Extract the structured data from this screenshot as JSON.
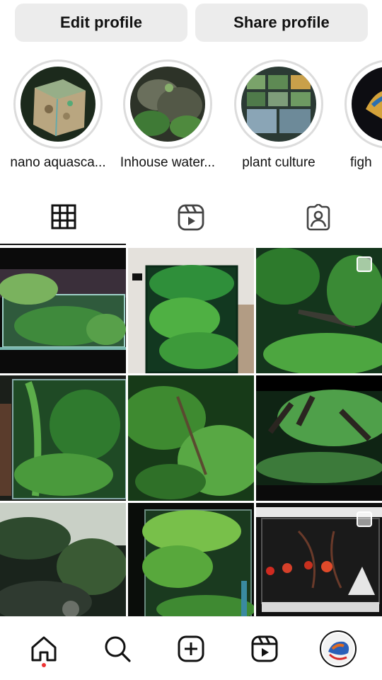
{
  "actions": {
    "edit_label": "Edit profile",
    "share_label": "Share profile"
  },
  "highlights": [
    {
      "label": "nano aquasca..."
    },
    {
      "label": "Inhouse water..."
    },
    {
      "label": "plant culture"
    },
    {
      "label": "figh"
    }
  ],
  "tabs": [
    {
      "icon": "grid-icon",
      "selected": true
    },
    {
      "icon": "reels-icon",
      "selected": false
    },
    {
      "icon": "tagged-icon",
      "selected": false
    }
  ],
  "posts": [
    {
      "multiple": false
    },
    {
      "multiple": false
    },
    {
      "multiple": true
    },
    {
      "multiple": false
    },
    {
      "multiple": false
    },
    {
      "multiple": false
    },
    {
      "multiple": false
    },
    {
      "multiple": false
    },
    {
      "multiple": true
    }
  ],
  "bottom_nav": [
    {
      "icon": "home-icon",
      "active": true,
      "notification_dot": true
    },
    {
      "icon": "search-icon",
      "active": false
    },
    {
      "icon": "create-icon",
      "active": false
    },
    {
      "icon": "reels-icon",
      "active": false
    },
    {
      "icon": "profile-avatar",
      "active": false
    }
  ],
  "colors": {
    "button_bg": "#ececec",
    "ring": "#dcdcdc",
    "notification_dot": "#ee3333"
  }
}
